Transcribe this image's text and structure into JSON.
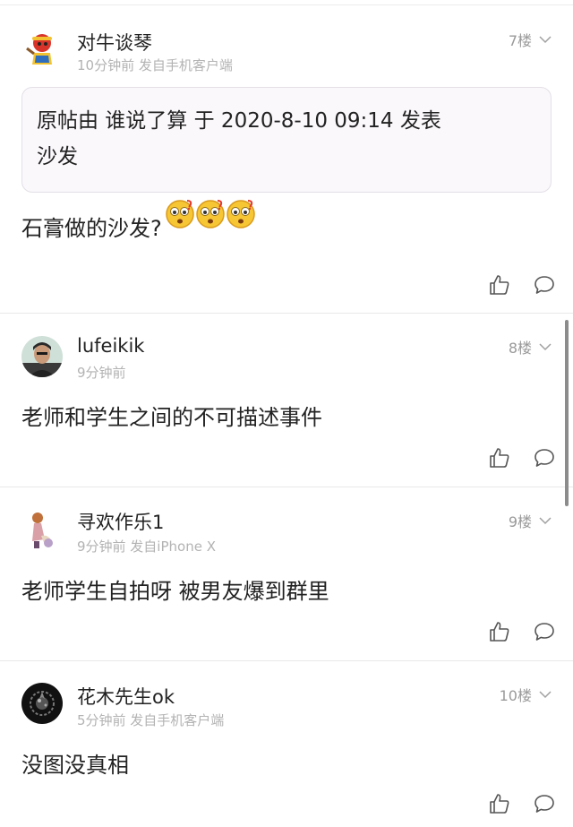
{
  "posts": [
    {
      "username": "对牛谈琴",
      "meta": "10分钟前 发自手机客户端",
      "floor": "7楼",
      "quote": {
        "line1": "原帖由 谁说了算 于 2020-8-10 09:14 发表",
        "line2": "沙发"
      },
      "content": "石膏做的沙发?",
      "emoji_count": 3
    },
    {
      "username": "lufeikik",
      "meta": "9分钟前",
      "floor": "8楼",
      "content": "老师和学生之间的不可描述事件"
    },
    {
      "username": "寻欢作乐1",
      "meta": "9分钟前 发自iPhone X",
      "floor": "9楼",
      "content": "老师学生自拍呀 被男友爆到群里"
    },
    {
      "username": "花木先生ok",
      "meta": "5分钟前 发自手机客户端",
      "floor": "10楼",
      "content": "没图没真相"
    }
  ],
  "icons": {
    "like": "thumbs-up-icon",
    "comment": "comment-bubble-icon",
    "expand": "chevron-down-icon",
    "emoji": "shocked-face-emoji"
  },
  "colors": {
    "text": "#222222",
    "meta": "#b3b3b3",
    "floor": "#9a9a9a",
    "quote_bg": "#fbf8fc",
    "separator": "#e8e8e8"
  }
}
